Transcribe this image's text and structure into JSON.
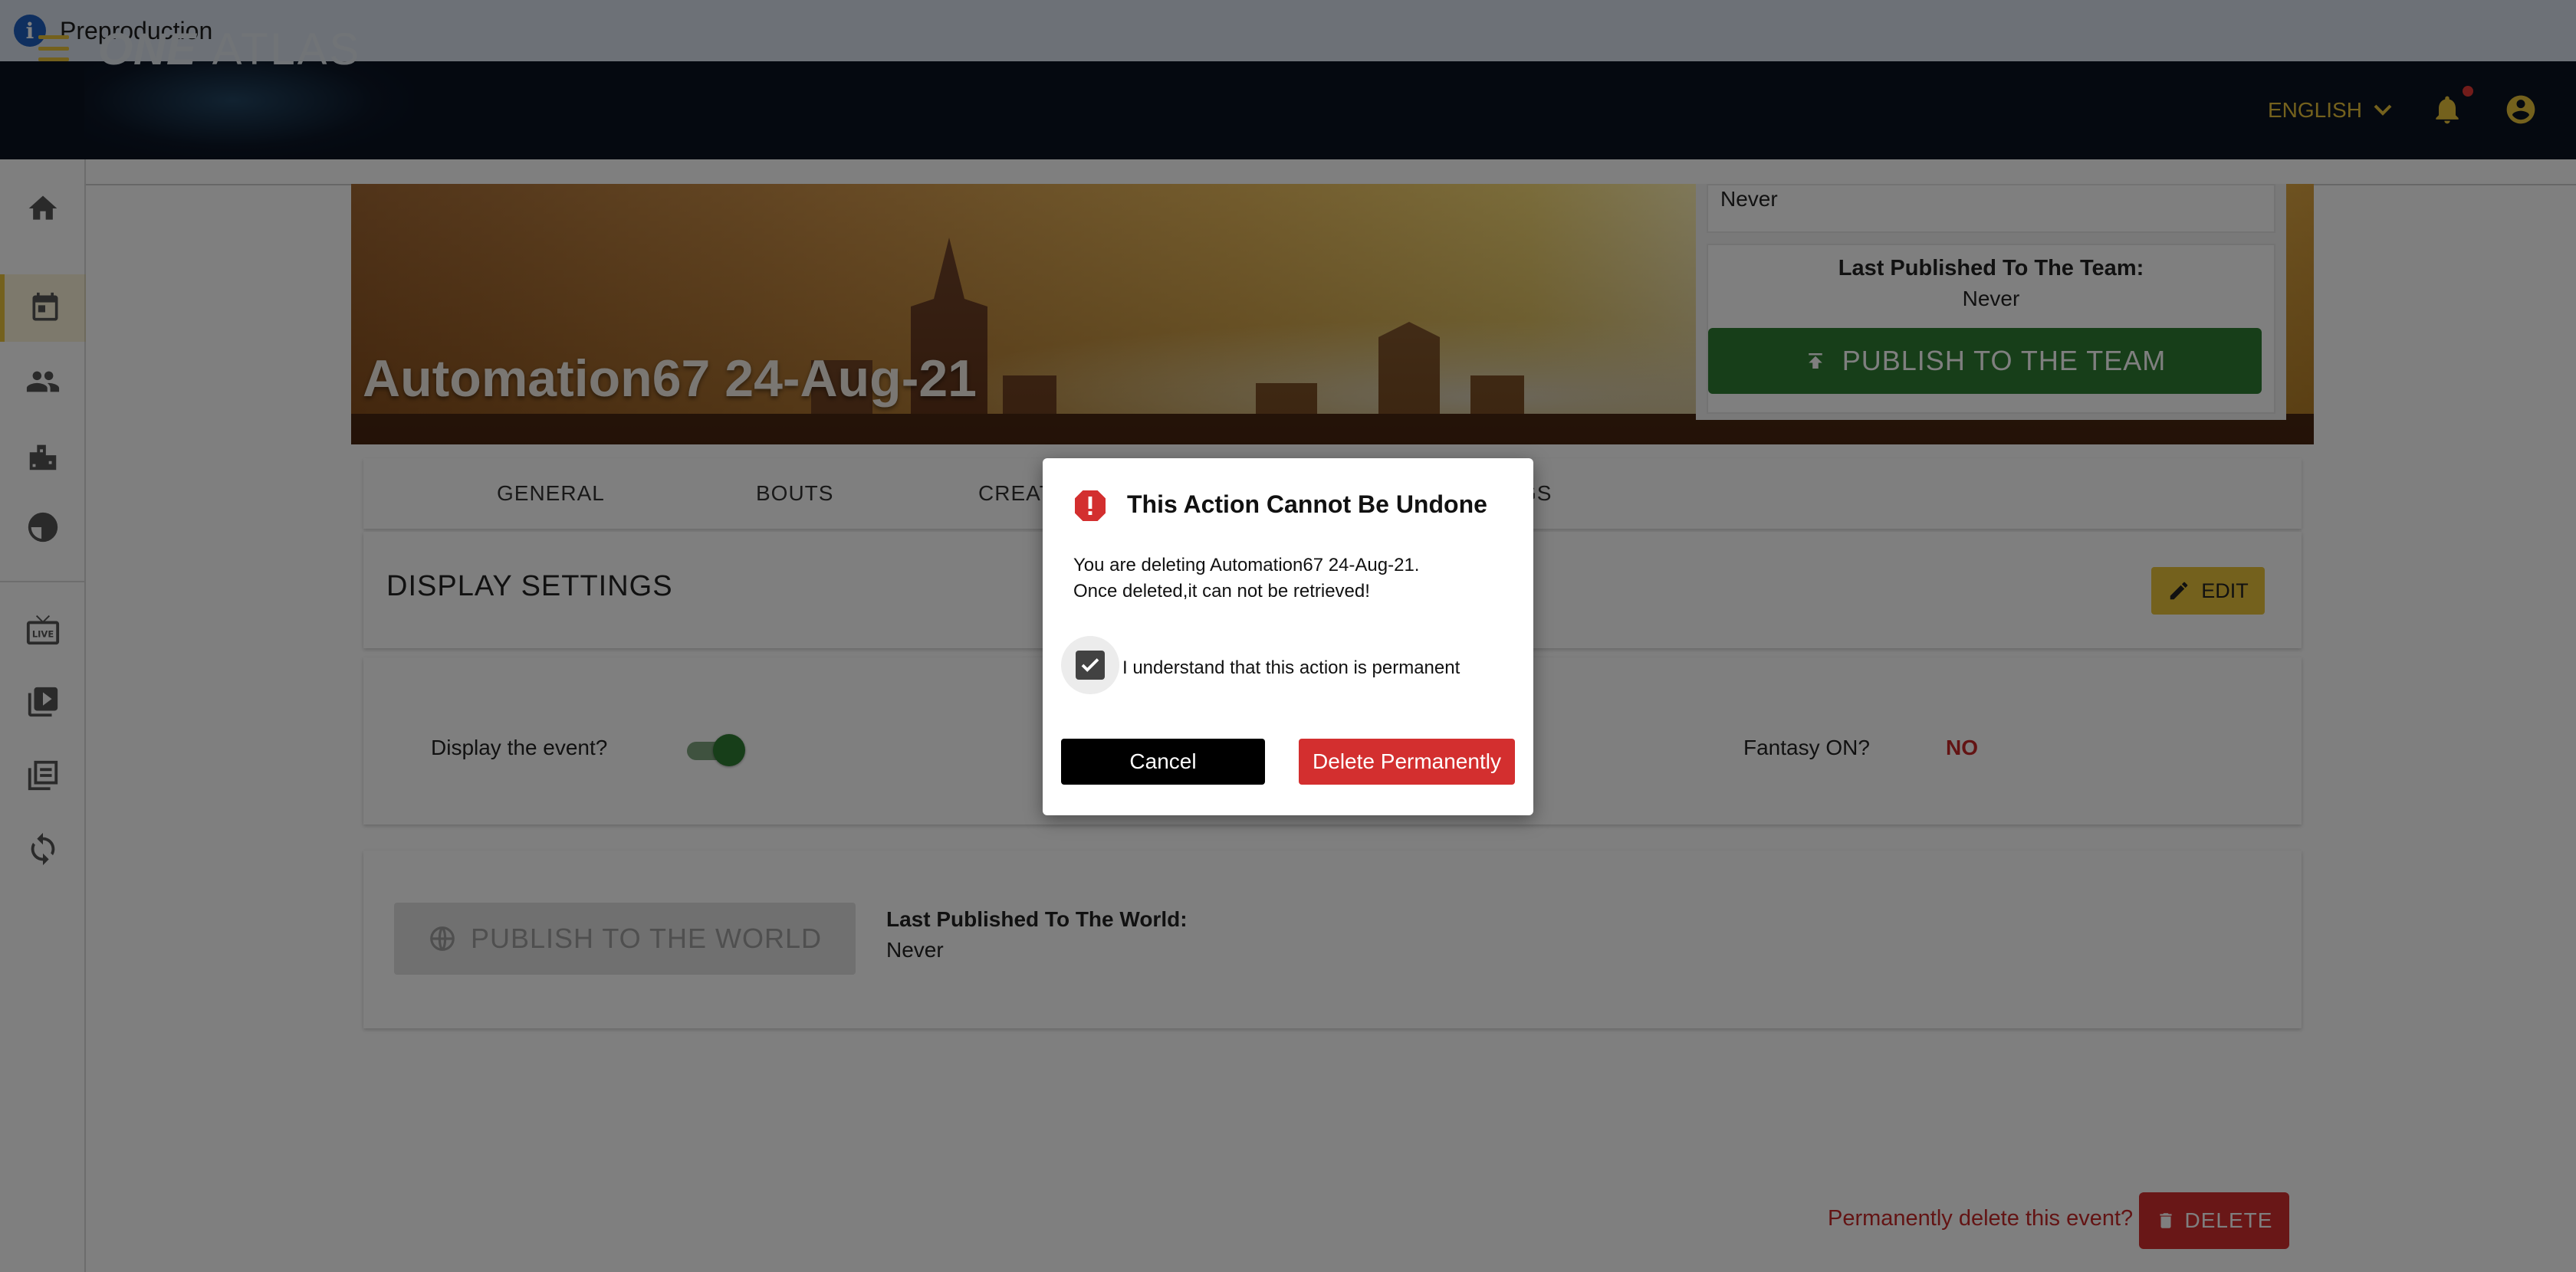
{
  "environment": {
    "label": "Preproduction",
    "icon": "info-icon"
  },
  "header": {
    "brand_one": "ONE",
    "brand_atlas": "ATLAS",
    "language": "ENGLISH",
    "icons": [
      "menu-icon",
      "chevron-down-icon",
      "bell-icon",
      "account-icon"
    ],
    "accent_color": "#e8c23b",
    "background_color": "#0a1221"
  },
  "sidebar": {
    "items": [
      {
        "name": "home",
        "icon": "home-icon",
        "active": false
      },
      {
        "name": "events",
        "icon": "calendar-icon",
        "active": true
      },
      {
        "name": "people",
        "icon": "people-icon",
        "active": false
      },
      {
        "name": "venues",
        "icon": "buildings-icon",
        "active": false
      },
      {
        "name": "shield",
        "icon": "shield-icon",
        "active": false
      },
      {
        "name": "live",
        "icon": "live-tv-icon",
        "active": false
      },
      {
        "name": "videos",
        "icon": "video-library-icon",
        "active": false
      },
      {
        "name": "collections",
        "icon": "library-icon",
        "active": false
      },
      {
        "name": "sync",
        "icon": "sync-icon",
        "active": false
      }
    ]
  },
  "event": {
    "title": "Automation67 24-Aug-21",
    "top_never": "Never",
    "team_publish_label": "Last Published To The Team:",
    "team_publish_value": "Never",
    "publish_team_button": "PUBLISH TO THE TEAM"
  },
  "tabs": [
    {
      "label": "GENERAL"
    },
    {
      "label": "BOUTS"
    },
    {
      "label": "CREAT"
    },
    {
      "label": "GS"
    }
  ],
  "display_settings": {
    "title": "DISPLAY SETTINGS",
    "edit_button": "EDIT",
    "display_event_label": "Display the event?",
    "display_event_on": true,
    "fantasy_label": "Fantasy ON?",
    "fantasy_value": "NO"
  },
  "world": {
    "publish_button": "PUBLISH TO THE WORLD",
    "label": "Last Published To The World:",
    "value": "Never"
  },
  "delete": {
    "prompt": "Permanently delete this event?",
    "button": "DELETE"
  },
  "dialog": {
    "title": "This Action Cannot Be Undone",
    "message_line1": "You are deleting Automation67 24-Aug-21.",
    "message_line2": "Once deleted,it can not be retrieved!",
    "checkbox_label": "I understand that this action is permanent",
    "checkbox_checked": true,
    "cancel": "Cancel",
    "confirm": "Delete Permanently",
    "danger_color": "#d32f2f"
  }
}
